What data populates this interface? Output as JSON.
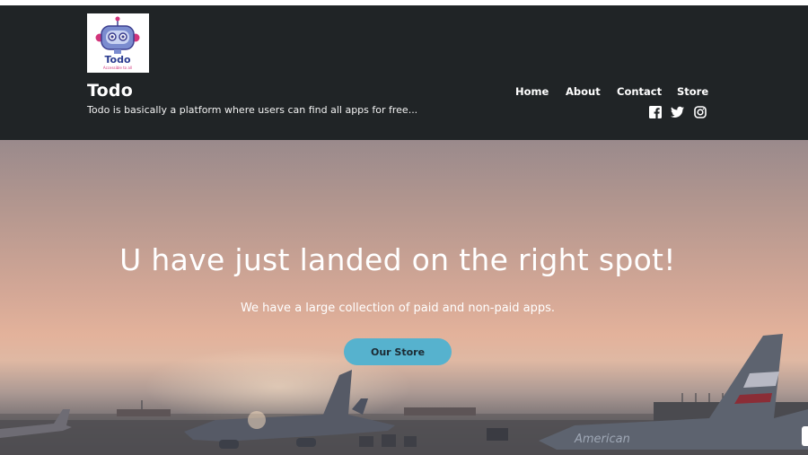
{
  "header": {
    "logo": {
      "name": "Todo",
      "tagline": "Accessible to all"
    },
    "site_title": "Todo",
    "tagline": "Todo is basically a platform where users can find all apps for free...",
    "nav": [
      {
        "label": "Home"
      },
      {
        "label": "About"
      },
      {
        "label": "Contact"
      },
      {
        "label": "Store"
      }
    ],
    "social": [
      "facebook-icon",
      "twitter-icon",
      "instagram-icon"
    ]
  },
  "hero": {
    "title": "U have just landed on the right spot!",
    "subtitle": "We have a large collection of paid and non-paid apps.",
    "button_label": "Our Store",
    "plane_livery": "American"
  },
  "colors": {
    "header_bg": "#202426",
    "button_bg": "#56b2ce",
    "hero_sky": "#d3a796"
  }
}
